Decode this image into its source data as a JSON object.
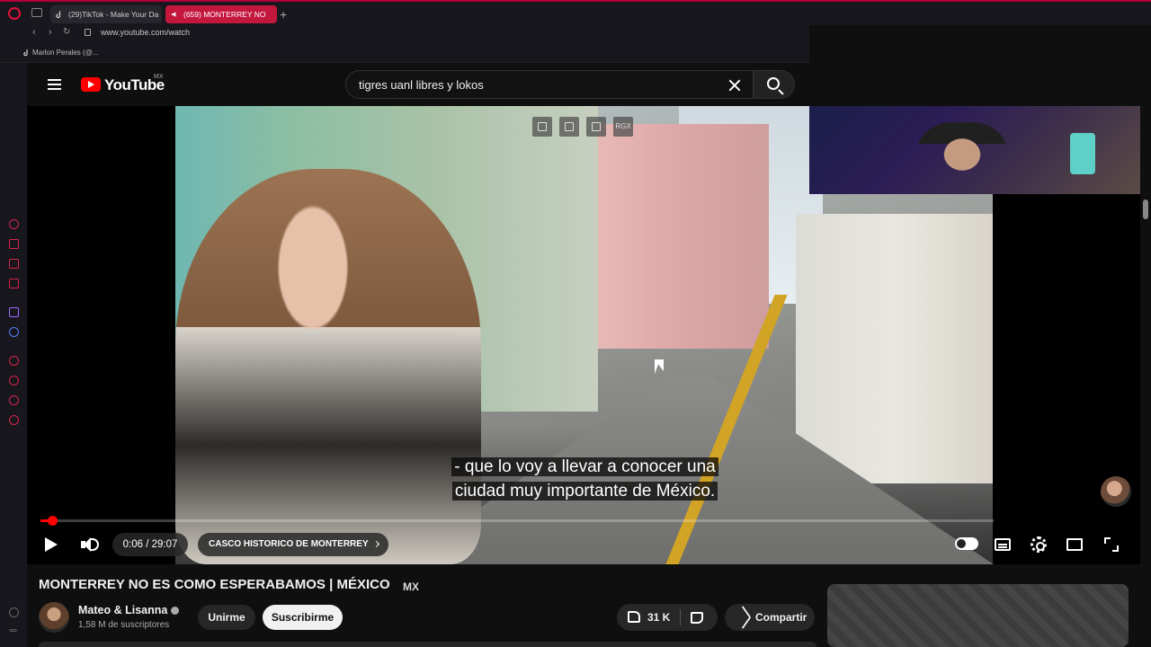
{
  "browser": {
    "tabs": [
      {
        "label": "(29)TikTok - Make Your Da"
      },
      {
        "label": "(659) MONTERREY NO"
      }
    ],
    "url": "www.youtube.com/watch",
    "bookmark": "Marlon Perales (@..."
  },
  "youtube": {
    "wordmark": "YouTube",
    "region": "MX",
    "search_value": "tigres uanl libres y lokos"
  },
  "player": {
    "caption_line1": "- que lo voy a llevar a conocer una",
    "caption_line2": "ciudad muy importante de México.",
    "rgx_label": "RGX",
    "time": "0:06 / 29:07",
    "chapter": "CASCO HISTORICO DE MONTERREY",
    "progress": 0.0034
  },
  "video": {
    "title": "MONTERREY NO ES COMO ESPERABAMOS | MÉXICO",
    "title_badge": "MX",
    "channel_name": "Mateo & Lisanna",
    "subscribers": "1,58 M de suscriptores",
    "join_label": "Unirme",
    "subscribe_label": "Suscribirme",
    "likes": "31 K",
    "share_label": "Compartir"
  },
  "colors": {
    "accent": "#ff0000",
    "opera": "#e0113a",
    "active_tab": "#c4173e"
  }
}
